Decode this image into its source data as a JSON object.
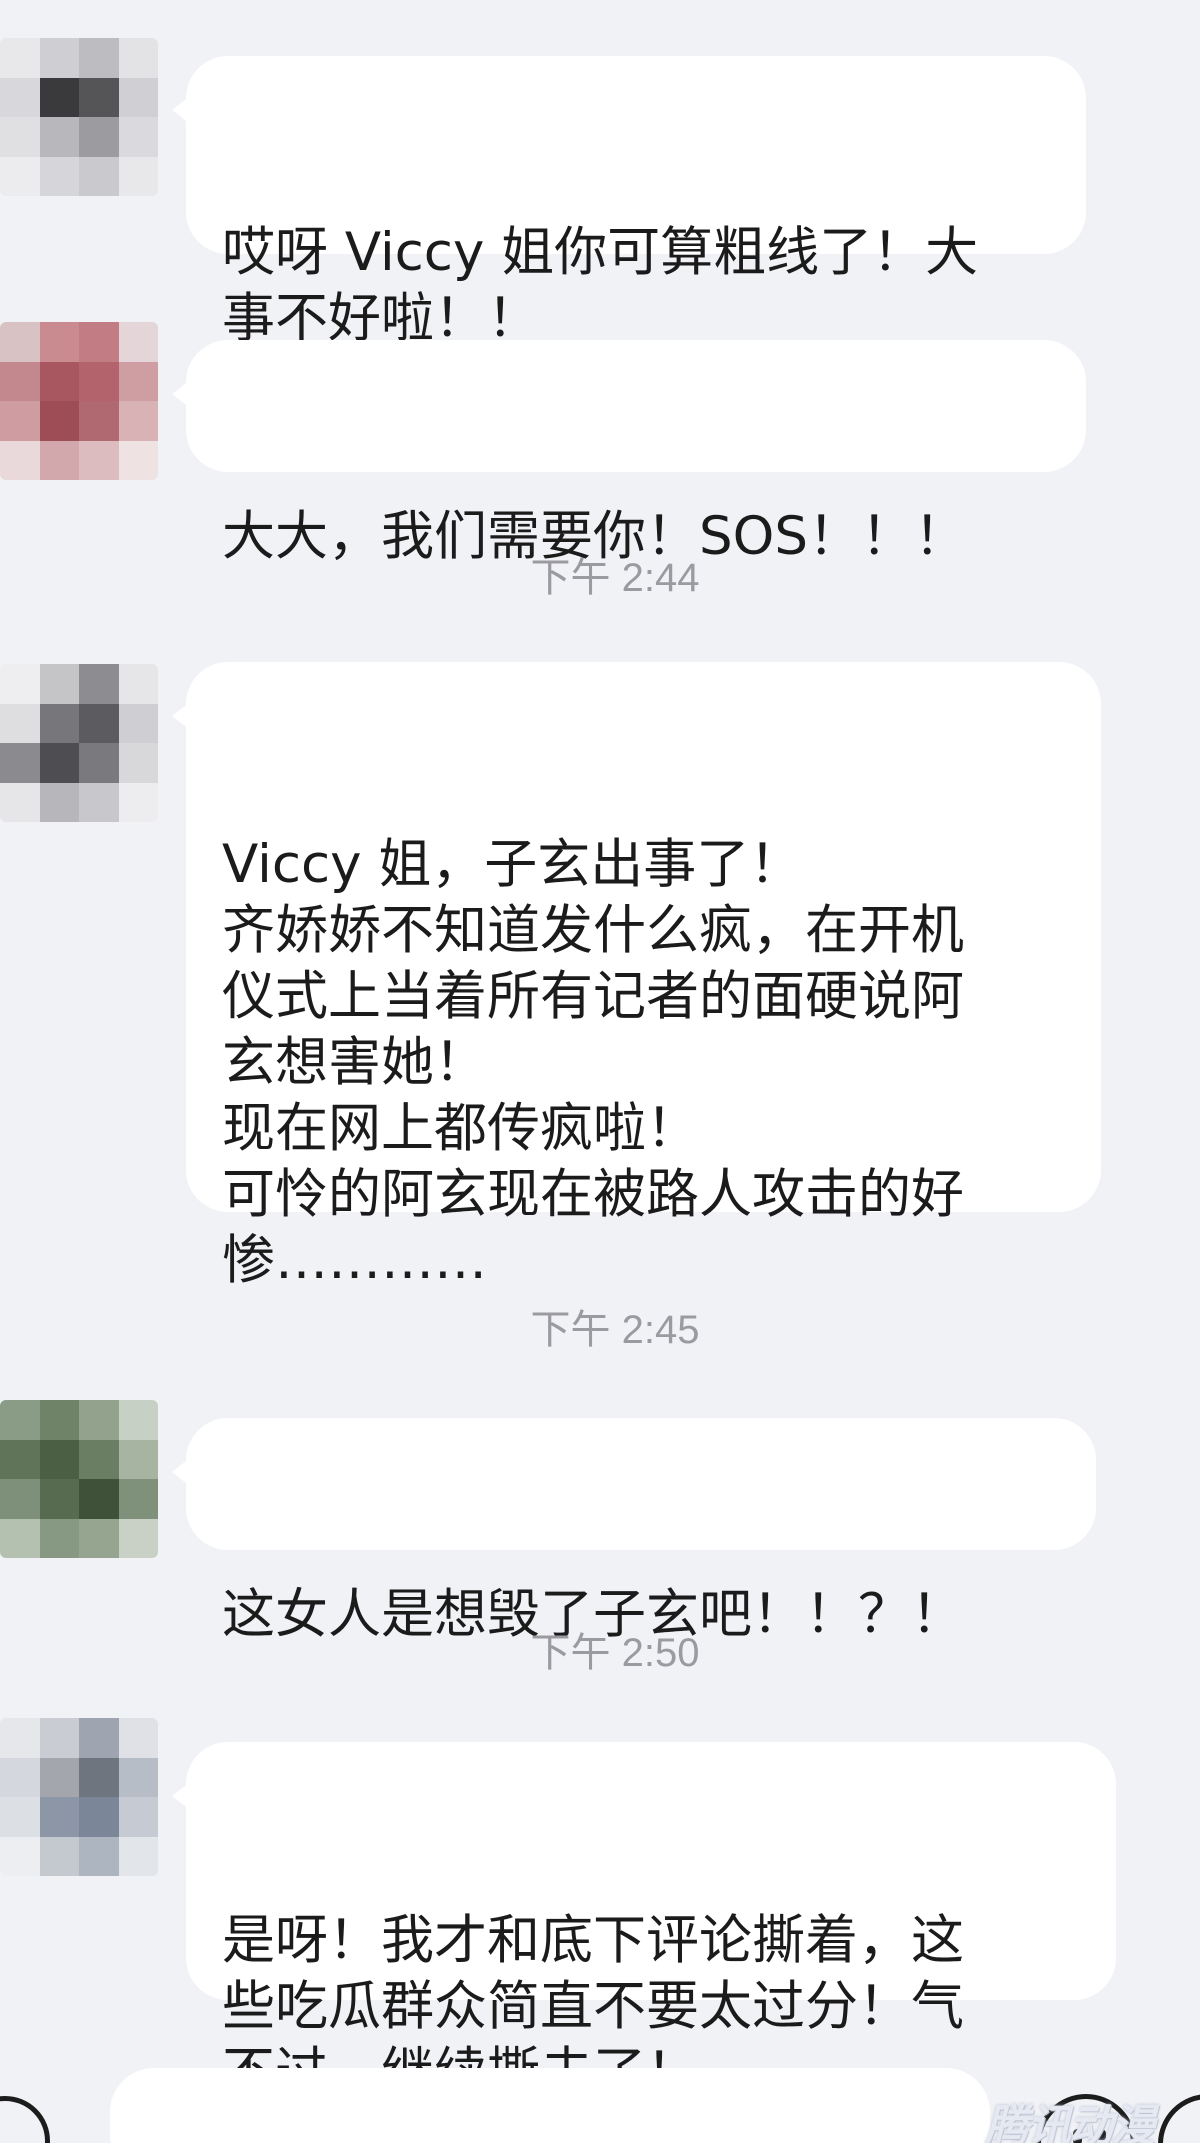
{
  "messages": [
    {
      "text": "哎呀 Viccy 姐你可算粗线了！大\n事不好啦！！"
    },
    {
      "text": "大大，我们需要你！SOS！！！"
    },
    {
      "text": "Viccy 姐，子玄出事了！\n齐娇娇不知道发什么疯，在开机\n仪式上当着所有记者的面硬说阿\n玄想害她！\n现在网上都传疯啦！\n可怜的阿玄现在被路人攻击的好\n惨…………"
    },
    {
      "text": "这女人是想毁了子玄吧！！？！"
    },
    {
      "text": "是呀！我才和底下评论撕着，这\n些吃瓜群众简直不要太过分！气\n不过，继续撕去了！"
    }
  ],
  "timestamps": [
    "下午 2:44",
    "下午 2:45",
    "下午 2:50"
  ],
  "watermark": "腾讯动漫",
  "icons": {
    "voice": "voice-icon",
    "emoji": "emoji-icon",
    "plus": "plus-icon"
  },
  "colors": {
    "background": "#f1f2f6",
    "bubble": "#ffffff",
    "text": "#1b1b1b",
    "timestamp": "#9a9aa0"
  }
}
